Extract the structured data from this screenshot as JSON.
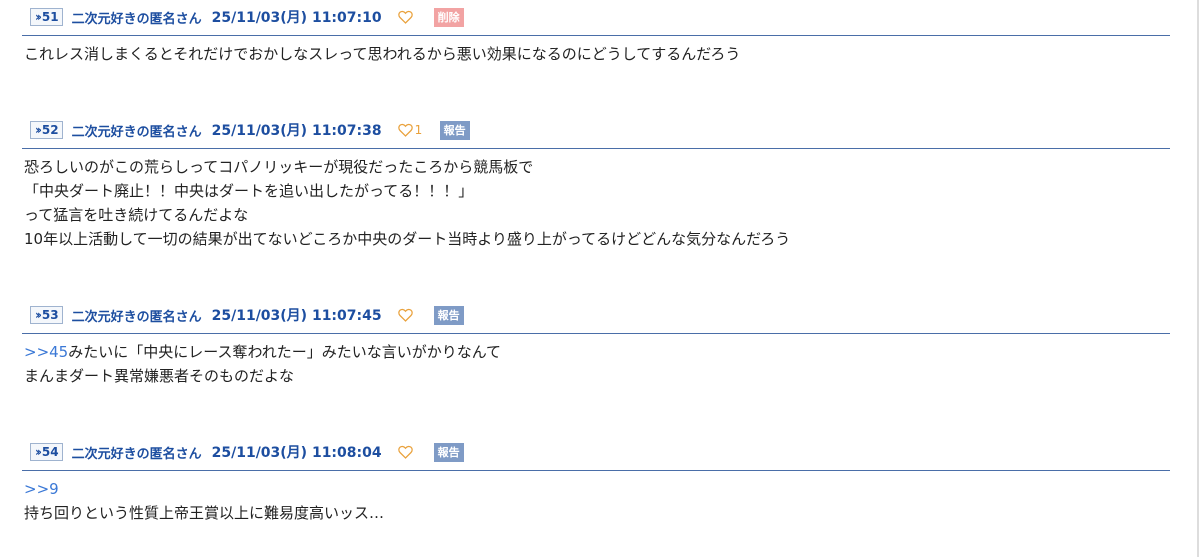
{
  "posts": [
    {
      "number": "51",
      "poster": "二次元好きの匿名さん",
      "date": "25/11/03(月) 11:07:10",
      "likes": "",
      "action": "削除",
      "action_type": "delete",
      "anchor": "",
      "lines": [
        "これレス消しまくるとそれだけでおかしなスレって思われるから悪い効果になるのにどうしてするんだろう"
      ]
    },
    {
      "number": "52",
      "poster": "二次元好きの匿名さん",
      "date": "25/11/03(月) 11:07:38",
      "likes": "1",
      "action": "報告",
      "action_type": "report",
      "anchor": "",
      "lines": [
        "恐ろしいのがこの荒らしってコパノリッキーが現役だったころから競馬板で",
        "「中央ダート廃止！！中央はダートを追い出したがってる！！！」",
        "って猛言を吐き続けてるんだよな",
        "10年以上活動して一切の結果が出てないどころか中央のダート当時より盛り上がってるけどどんな気分なんだろう"
      ]
    },
    {
      "number": "53",
      "poster": "二次元好きの匿名さん",
      "date": "25/11/03(月) 11:07:45",
      "likes": "",
      "action": "報告",
      "action_type": "report",
      "anchor": ">>45",
      "lines": [
        "みたいに「中央にレース奪われたー」みたいな言いがかりなんて",
        "まんまダート異常嫌悪者そのものだよな"
      ]
    },
    {
      "number": "54",
      "poster": "二次元好きの匿名さん",
      "date": "25/11/03(月) 11:08:04",
      "likes": "",
      "action": "報告",
      "action_type": "report",
      "anchor": ">>9",
      "anchor_own_line": true,
      "lines": [
        "持ち回りという性質上帝王賞以上に難易度高いッス…"
      ]
    }
  ],
  "icons": {
    "res_arrow": "double-chevron-right-icon",
    "like": "heart-outline-icon"
  },
  "colors": {
    "link_blue": "#1d4ea0",
    "anchor_blue": "#3a78d6",
    "heart_orange": "#e9a13b",
    "delete_pink": "#f2a3a3",
    "report_blue": "#7f9bc6",
    "divider": "#4a6ea8"
  }
}
